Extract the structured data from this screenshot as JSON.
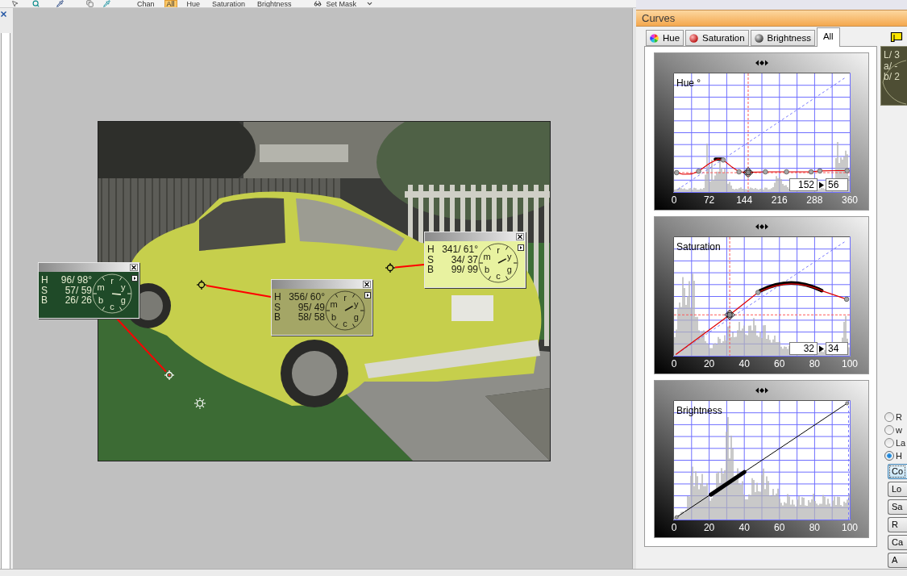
{
  "toolbar": {
    "items": [
      {
        "label": "Chan",
        "selected": false
      },
      {
        "label": "All",
        "selected": true
      },
      {
        "label": "Hue",
        "selected": false
      },
      {
        "label": "Saturation",
        "selected": false
      },
      {
        "label": "Brightness",
        "selected": false
      }
    ],
    "mask_button": "Set Mask"
  },
  "popups": [
    {
      "color": "#1f4a28",
      "rows": [
        {
          "label": "H",
          "value": "96/ 98°"
        },
        {
          "label": "S",
          "value": "57/ 59"
        },
        {
          "label": "B",
          "value": "26/ 26"
        }
      ],
      "dial_labels": [
        "r",
        "y",
        "g",
        "c",
        "b",
        "m"
      ]
    },
    {
      "color": "#a4a666",
      "rows": [
        {
          "label": "H",
          "value": "356/ 60°"
        },
        {
          "label": "S",
          "value": "95/ 49"
        },
        {
          "label": "B",
          "value": "58/ 58"
        }
      ],
      "dial_labels": [
        "r",
        "y",
        "g",
        "c",
        "b",
        "m"
      ]
    },
    {
      "color": "#e8f2a0",
      "rows": [
        {
          "label": "H",
          "value": "341/ 61°"
        },
        {
          "label": "S",
          "value": "34/ 37"
        },
        {
          "label": "B",
          "value": "99/ 99"
        }
      ],
      "dial_labels": [
        "r",
        "y",
        "g",
        "c",
        "b",
        "m"
      ]
    }
  ],
  "curves_panel": {
    "title": "Curves",
    "tabs": [
      {
        "kind": "hue",
        "label": "Hue",
        "selected": false
      },
      {
        "kind": "saturation",
        "label": "Saturation",
        "selected": false
      },
      {
        "kind": "brightness",
        "label": "Brightness",
        "selected": false
      },
      {
        "kind": "all",
        "label": "All",
        "selected": true
      }
    ],
    "charts": [
      {
        "kind": "hue",
        "title": "Hue °",
        "axis_labels": [
          "0",
          "72",
          "144",
          "216",
          "288",
          "360"
        ],
        "input": "152",
        "output": "56"
      },
      {
        "kind": "saturation",
        "title": "Saturation",
        "axis_labels": [
          "0",
          "20",
          "40",
          "60",
          "80",
          "100"
        ],
        "input": "32",
        "output": "34"
      },
      {
        "kind": "brightness",
        "title": "Brightness",
        "axis_labels": [
          "0",
          "20",
          "40",
          "60",
          "80",
          "100"
        ]
      }
    ],
    "readout": [
      "L/ 3",
      "a/ -",
      "b/ 2"
    ],
    "color_spaces": [
      {
        "label": "R",
        "selected": false
      },
      {
        "label": "w",
        "selected": false
      },
      {
        "label": "La",
        "selected": false
      },
      {
        "label": "H",
        "selected": true
      }
    ],
    "buttons": [
      {
        "label": "Co",
        "focused": true
      },
      {
        "label": "Lo",
        "focused": false
      },
      {
        "label": "Sa",
        "focused": false
      },
      {
        "label": "R",
        "focused": false
      },
      {
        "label": "Ca",
        "focused": false
      },
      {
        "label": "A",
        "focused": false
      }
    ]
  }
}
